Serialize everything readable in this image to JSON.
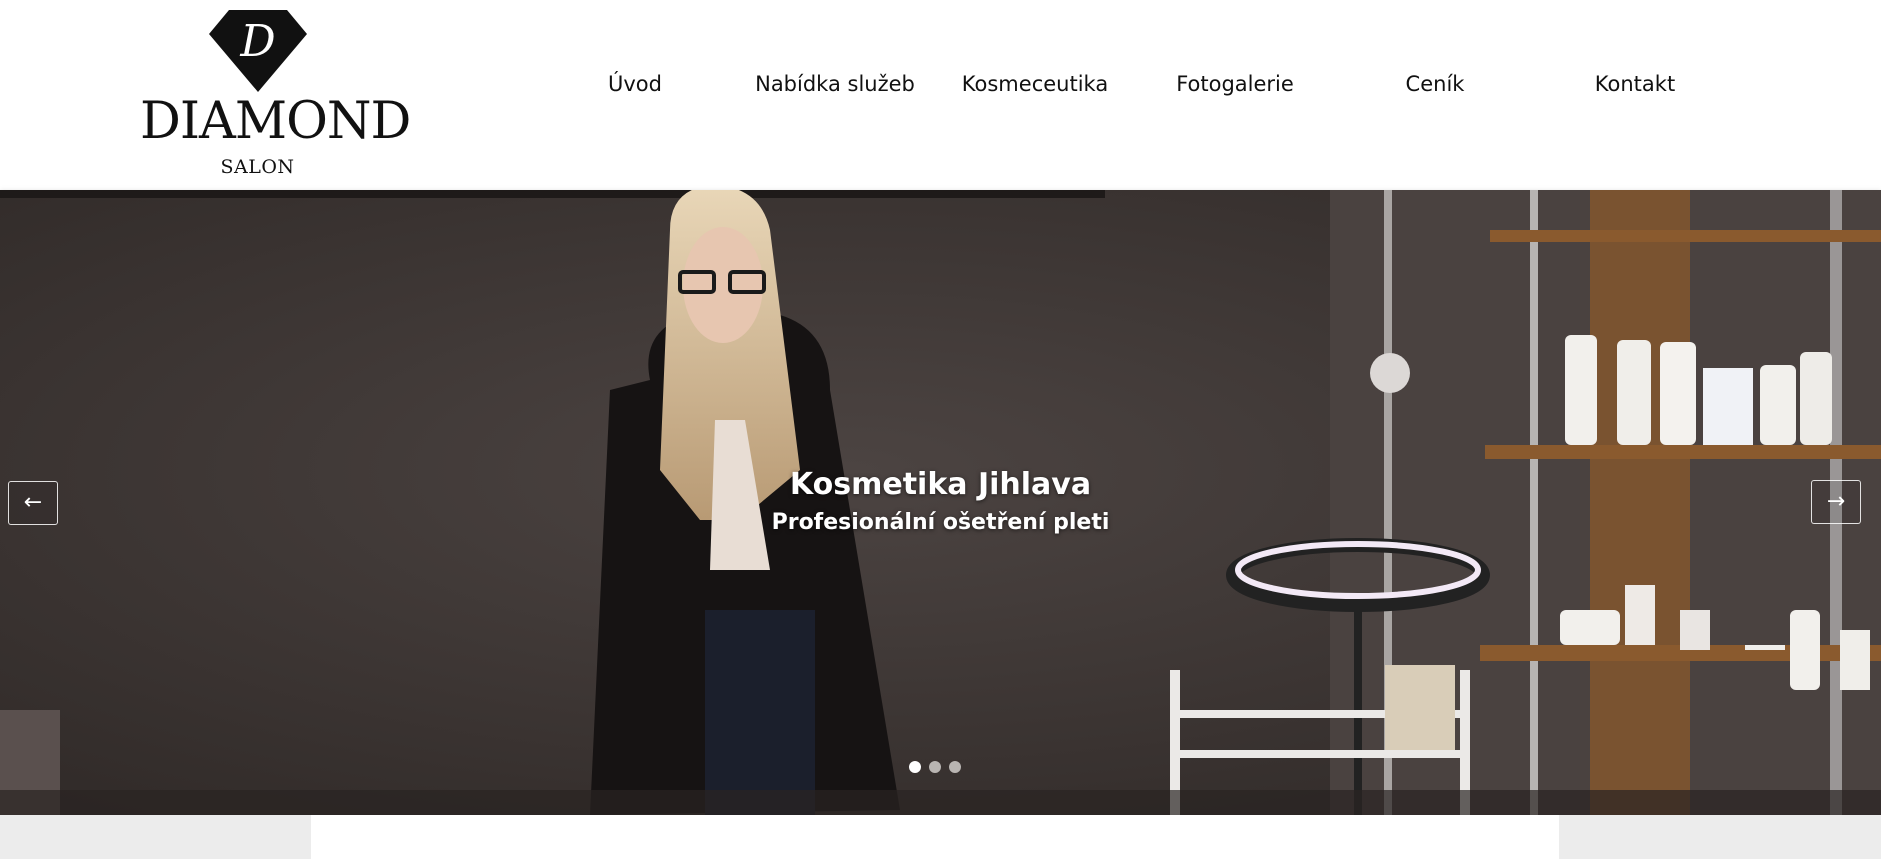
{
  "logo": {
    "monogram": "D",
    "name": "DIAMOND",
    "subtitle": "SALON"
  },
  "nav": {
    "items": [
      {
        "label": "Úvod"
      },
      {
        "label": "Nabídka služeb"
      },
      {
        "label": "Kosmeceutika"
      },
      {
        "label": "Fotogalerie"
      },
      {
        "label": "Ceník"
      },
      {
        "label": "Kontakt"
      }
    ]
  },
  "hero": {
    "title": "Kosmetika Jihlava",
    "subtitle": "Profesionální ošetření pleti",
    "prev_label": "←",
    "next_label": "→",
    "slide_count": 3,
    "active_slide": 1,
    "dot_active_color": "#ffffff",
    "dot_inactive_color": "#b9b5b2"
  },
  "colors": {
    "text": "#111111",
    "hero_bg": "#3f3836",
    "side_panel": "#ececec"
  }
}
